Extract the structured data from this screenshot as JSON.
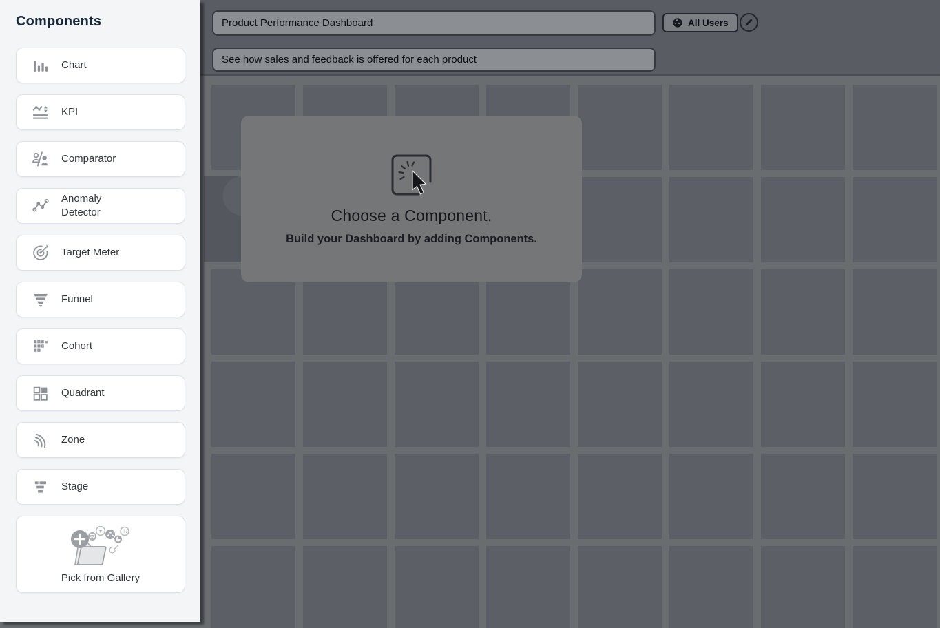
{
  "sidebar": {
    "title": "Components",
    "items": [
      {
        "label": "Chart",
        "icon": "bar-chart-icon"
      },
      {
        "label": "KPI",
        "icon": "kpi-trend-icon"
      },
      {
        "label": "Comparator",
        "icon": "comparator-icon"
      },
      {
        "label": "Anomaly Detector",
        "icon": "anomaly-detector-icon"
      },
      {
        "label": "Target Meter",
        "icon": "target-meter-icon"
      },
      {
        "label": "Funnel",
        "icon": "funnel-icon"
      },
      {
        "label": "Cohort",
        "icon": "cohort-icon"
      },
      {
        "label": "Quadrant",
        "icon": "quadrant-icon"
      },
      {
        "label": "Zone",
        "icon": "zone-icon"
      },
      {
        "label": "Stage",
        "icon": "stage-icon"
      }
    ],
    "gallery": {
      "label": "Pick from Gallery",
      "icon": "gallery-folder-icon"
    }
  },
  "header": {
    "title_input": {
      "value": "Product Performance Dashboard"
    },
    "description_input": {
      "value": "See how sales and feedback is offered for each product"
    },
    "audience_button": {
      "label": "All Users",
      "icon": "globe-icon"
    },
    "edit_button": {
      "icon": "pencil-icon"
    }
  },
  "canvas": {
    "empty_state": {
      "title": "Choose a Component.",
      "subtitle": "Build your Dashboard by adding Components.",
      "icon": "click-select-icon"
    },
    "grid": {
      "columns": 8,
      "rows": 6
    }
  },
  "colors": {
    "header_band": "#595d63",
    "canvas_background": "#6a6d70",
    "grid_tile": "#5c6066",
    "empty_panel": "#747678",
    "sidebar_background": "#f4f5f7",
    "card_border": "#dbe3ea",
    "icon_gray": "#8f9399",
    "heading_navy": "#17293a"
  }
}
